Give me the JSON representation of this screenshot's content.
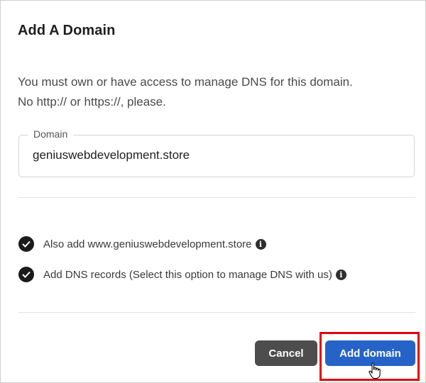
{
  "dialog": {
    "title": "Add A Domain",
    "description_line1": "You must own or have access to manage DNS for this domain.",
    "description_line2": "No http:// or https://, please."
  },
  "domain_field": {
    "label": "Domain",
    "value": "geniuswebdevelopment.store"
  },
  "options": [
    {
      "label": "Also add www.geniuswebdevelopment.store",
      "checked": true,
      "icon": "check-circle-icon",
      "info_icon": "info-icon"
    },
    {
      "label": "Add DNS records (Select this option to manage DNS with us)",
      "checked": true,
      "icon": "check-circle-icon",
      "info_icon": "info-icon"
    }
  ],
  "buttons": {
    "cancel": "Cancel",
    "add_domain": "Add domain"
  },
  "colors": {
    "primary": "#2563c9",
    "cancel": "#4d4d4d",
    "highlight": "#e4000f"
  }
}
